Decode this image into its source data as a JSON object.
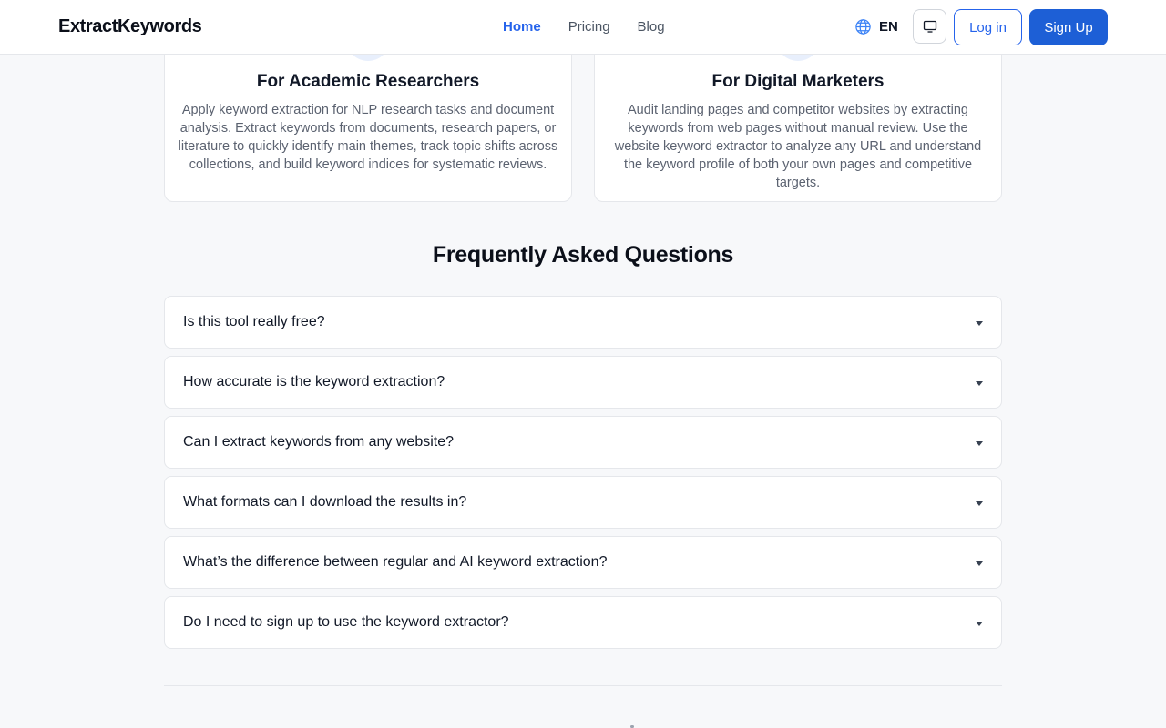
{
  "header": {
    "logo": "ExtractKeywords",
    "nav": [
      {
        "label": "Home",
        "active": true
      },
      {
        "label": "Pricing",
        "active": false
      },
      {
        "label": "Blog",
        "active": false
      }
    ],
    "language": "EN",
    "language_icon": "globe-icon",
    "display_icon": "monitor-icon",
    "login_label": "Log in",
    "signup_label": "Sign Up"
  },
  "features": [
    {
      "title": "For Academic Researchers",
      "text": "Apply keyword extraction for NLP research tasks and document analysis. Extract keywords from documents, research papers, or literature to quickly identify main themes, track topic shifts across collections, and build keyword indices for systematic reviews."
    },
    {
      "title": "For Digital Marketers",
      "text": "Audit landing pages and competitor websites by extracting keywords from web pages without manual review. Use the website keyword extractor to analyze any URL and understand the keyword profile of both your own pages and competitive targets."
    }
  ],
  "faq": {
    "title": "Frequently Asked Questions",
    "items": [
      "Is this tool really free?",
      "How accurate is the keyword extraction?",
      "Can I extract keywords from any website?",
      "What formats can I download the results in?",
      "What’s the difference between regular and AI keyword extraction?",
      "Do I need to sign up to use the keyword extractor?"
    ]
  },
  "colors": {
    "accent": "#2563eb",
    "signup_bg": "#1d5fd6",
    "page_bg": "#f7f8fa"
  }
}
